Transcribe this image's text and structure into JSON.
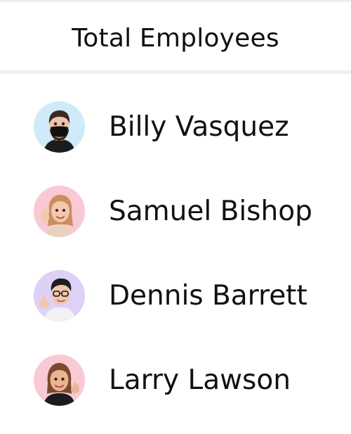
{
  "header": {
    "title": "Total Employees"
  },
  "employees": [
    {
      "name": "Billy Vasquez",
      "avatar_icon": "memoji-man-face-mask-icon",
      "avatar_bg": "#cfeaf8"
    },
    {
      "name": "Samuel Bishop",
      "avatar_icon": "memoji-woman-blonde-waving-icon",
      "avatar_bg": "#f9c9d4"
    },
    {
      "name": "Dennis Barrett",
      "avatar_icon": "memoji-man-glasses-thumbs-up-icon",
      "avatar_bg": "#ddd1f6"
    },
    {
      "name": "Larry Lawson",
      "avatar_icon": "memoji-woman-brown-hair-shrug-icon",
      "avatar_bg": "#f9c9d4"
    }
  ]
}
